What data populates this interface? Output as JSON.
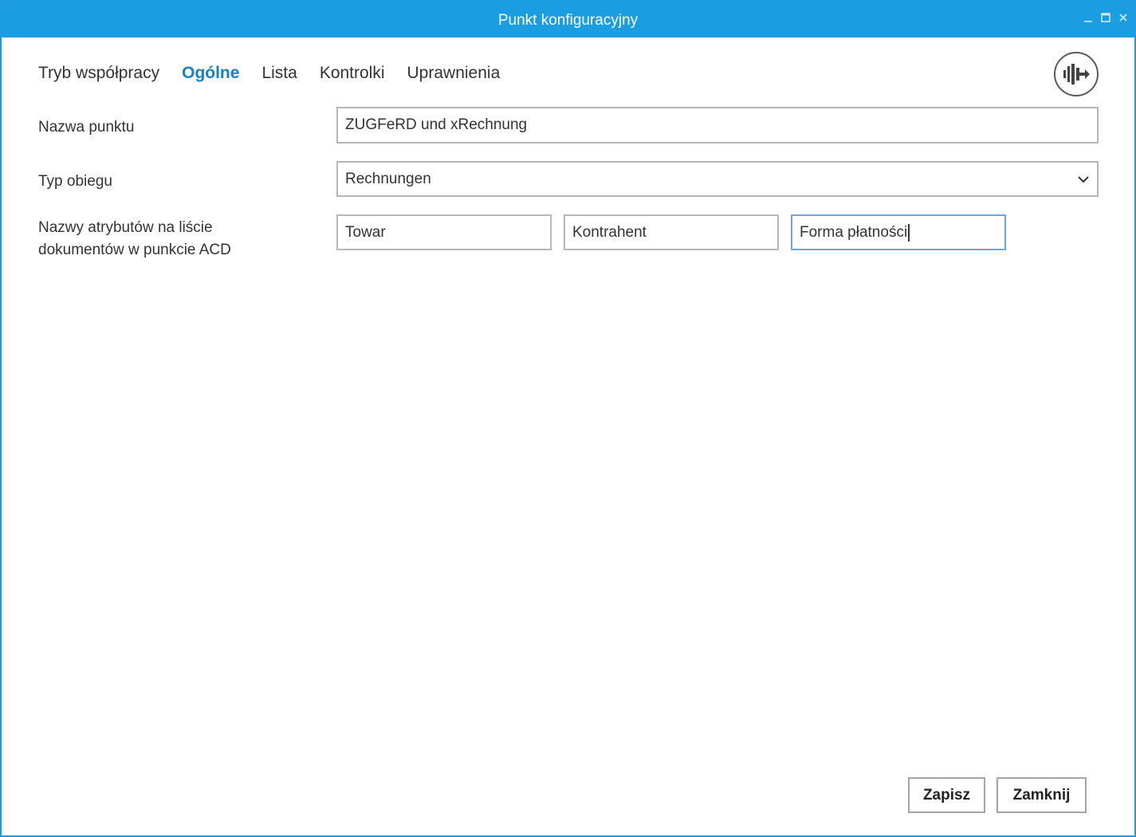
{
  "window": {
    "title": "Punkt konfiguracyjny",
    "accent_color": "#1b9de2"
  },
  "tabs": [
    {
      "label": "Tryb współpracy",
      "active": false
    },
    {
      "label": "Ogólne",
      "active": true
    },
    {
      "label": "Lista",
      "active": false
    },
    {
      "label": "Kontrolki",
      "active": false
    },
    {
      "label": "Uprawnienia",
      "active": false
    }
  ],
  "form": {
    "point_name": {
      "label": "Nazwa punktu",
      "value": "ZUGFeRD und xRechnung"
    },
    "flow_type": {
      "label": "Typ obiegu",
      "selected": "Rechnungen"
    },
    "attribute_names": {
      "label_line1": "Nazwy atrybutów na liście",
      "label_line2": "dokumentów w punkcie ACD",
      "values": [
        "Towar",
        "Kontrahent",
        "Forma płatności"
      ]
    }
  },
  "buttons": {
    "save": "Zapisz",
    "close": "Zamknij"
  },
  "icons": {
    "title_minimize": "minimize-icon",
    "title_maximize": "maximize-icon",
    "title_close": "close-icon",
    "command": "tiles-arrow-icon",
    "select_chevron": "chevron-down-icon"
  }
}
